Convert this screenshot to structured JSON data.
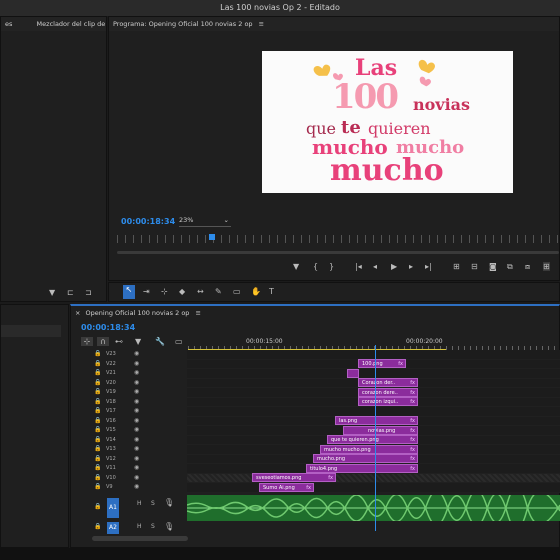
{
  "window_title": "Las 100 novias Op 2",
  "window_status": "- Editado",
  "source_panel": {
    "tab1": "es",
    "tab2": "Mezclador del clip de au"
  },
  "program_monitor": {
    "title": "Programa: Opening Oficial 100 novias 2 op",
    "timecode": "00:00:18:34",
    "zoom": "23%",
    "preview_text": {
      "line1": "Las",
      "line2a": "100",
      "line2b": "novias",
      "line3a": "que",
      "line3b": "te",
      "line3c": "quieren",
      "line4a": "mucho",
      "line4b": "mucho",
      "line5": "mucho"
    }
  },
  "timeline": {
    "title": "Opening Oficial 100 novias 2 op",
    "timecode": "00:00:18:34",
    "ruler_labels": [
      "00:00:15:00",
      "00:00:20:00"
    ],
    "tracks": [
      {
        "id": "V23"
      },
      {
        "id": "V22"
      },
      {
        "id": "V21"
      },
      {
        "id": "V20"
      },
      {
        "id": "V19"
      },
      {
        "id": "V18"
      },
      {
        "id": "V17"
      },
      {
        "id": "V16"
      },
      {
        "id": "V15"
      },
      {
        "id": "V14"
      },
      {
        "id": "V13"
      },
      {
        "id": "V12"
      },
      {
        "id": "V11"
      },
      {
        "id": "V10"
      },
      {
        "id": "V9"
      }
    ],
    "audio_track": "A1",
    "audio_track2": "A2",
    "clips": [
      {
        "track": "V22",
        "label": "100.png"
      },
      {
        "track": "V21",
        "label": ""
      },
      {
        "track": "V20",
        "label": "Corazon der.."
      },
      {
        "track": "V19",
        "label": "corazon dere.."
      },
      {
        "track": "V18",
        "label": "corazon izqui.."
      },
      {
        "track": "V16",
        "label": "las.png"
      },
      {
        "track": "V15",
        "label": "novias.png"
      },
      {
        "track": "V14",
        "label": "que te quieren.png"
      },
      {
        "track": "V13",
        "label": "mucho mucho.png"
      },
      {
        "track": "V12",
        "label": "mucho.png"
      },
      {
        "track": "V11",
        "label": "titulo4.png"
      },
      {
        "track": "V10",
        "label": "sveseotiamos.png"
      },
      {
        "track": "V9",
        "label": "Sumo Ai.png"
      }
    ],
    "fx": "fx",
    "h_label": "H",
    "s_label": "S"
  },
  "colors": {
    "accent": "#2d8ceb",
    "clip": "#8b2c9c",
    "audio": "#1f6e2c",
    "pink": "#e8417a",
    "heart": "#f5c04a"
  }
}
